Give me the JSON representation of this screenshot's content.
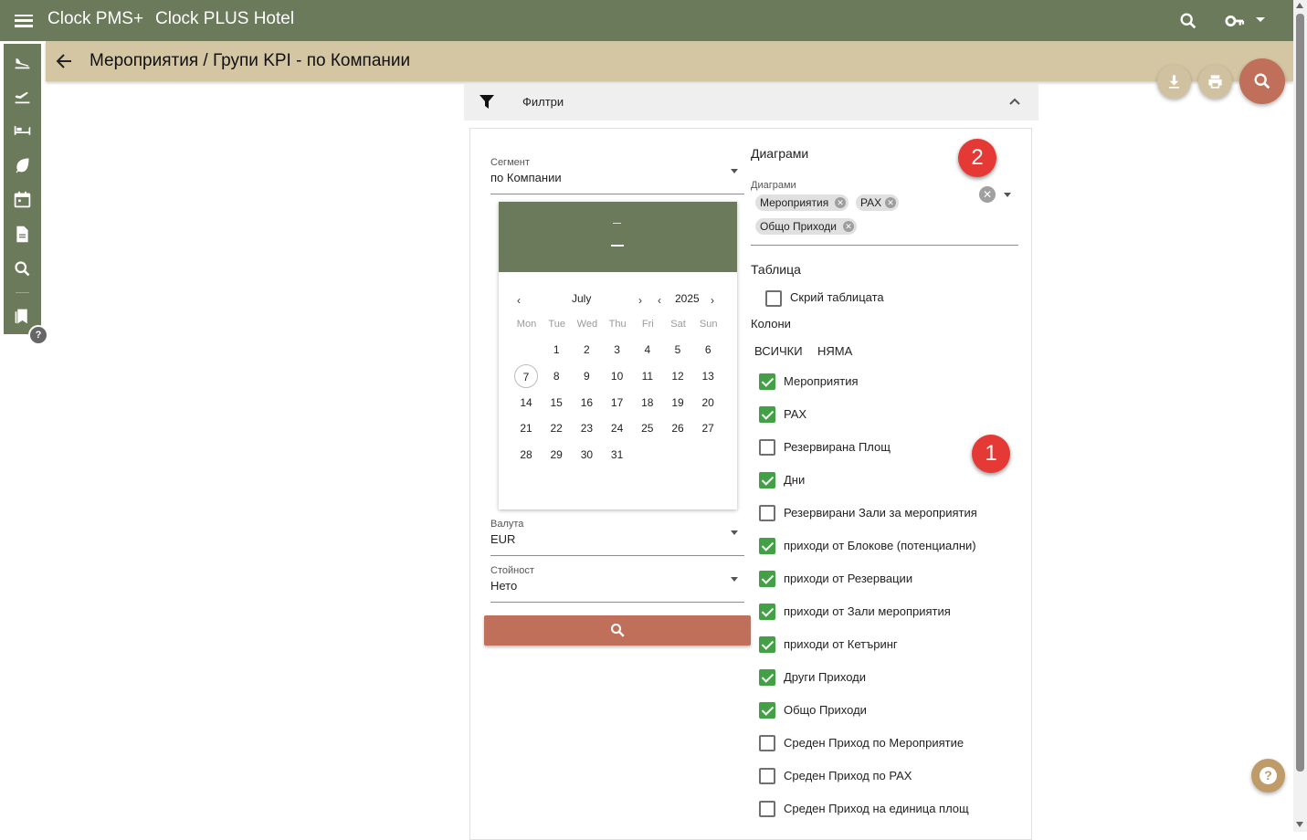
{
  "topbar": {
    "app_title": "Clock PMS+",
    "hotel_name": "Clock PLUS Hotel",
    "icons": [
      "menu-icon",
      "search-icon",
      "key-icon",
      "caret-down-icon"
    ]
  },
  "header": {
    "title": "Мероприятия / Групи KPI - по Компании"
  },
  "sidebar": {
    "icons": [
      "arrivals-icon",
      "departures-icon",
      "bed-icon",
      "leaf-icon",
      "calendar-icon",
      "document-icon",
      "search-icon",
      "bookmarks-icon",
      "help-icon"
    ]
  },
  "filters": {
    "label": "Филтри"
  },
  "segment": {
    "label": "Сегмент",
    "value": "по Компании"
  },
  "calendar": {
    "month": "July",
    "year": "2025",
    "weekdays": [
      "Mon",
      "Tue",
      "Wed",
      "Thu",
      "Fri",
      "Sat",
      "Sun"
    ],
    "days": [
      "1",
      "2",
      "3",
      "4",
      "5",
      "6",
      "7",
      "8",
      "9",
      "10",
      "11",
      "12",
      "13",
      "14",
      "15",
      "16",
      "17",
      "18",
      "19",
      "20",
      "21",
      "22",
      "23",
      "24",
      "25",
      "26",
      "27",
      "28",
      "29",
      "30",
      "31"
    ],
    "today": "7"
  },
  "currency": {
    "label": "Валута",
    "value": "EUR"
  },
  "value_type": {
    "label": "Стойност",
    "value": "Нето"
  },
  "charts": {
    "section_title": "Диаграми",
    "field_label": "Диаграми",
    "chips": [
      "Мероприятия",
      "PAX",
      "Общо Приходи"
    ]
  },
  "table": {
    "section_title": "Таблица",
    "hide_table_label": "Скрий таблицата",
    "hide_table_checked": false,
    "columns_title": "Колони",
    "all_label": "ВСИЧКИ",
    "none_label": "НЯМА",
    "columns": [
      {
        "label": "Мероприятия",
        "checked": true
      },
      {
        "label": "PAX",
        "checked": true
      },
      {
        "label": "Резервирана Площ",
        "checked": false
      },
      {
        "label": "Дни",
        "checked": true
      },
      {
        "label": "Резервирани Зали за мероприятия",
        "checked": false
      },
      {
        "label": "приходи от Блокове (потенциални)",
        "checked": true
      },
      {
        "label": "приходи от Резервации",
        "checked": true
      },
      {
        "label": "приходи от Зали мероприятия",
        "checked": true
      },
      {
        "label": "приходи от Кетъринг",
        "checked": true
      },
      {
        "label": "Други Приходи",
        "checked": true
      },
      {
        "label": "Общо Приходи",
        "checked": true
      },
      {
        "label": "Среден Приход по Мероприятие",
        "checked": false
      },
      {
        "label": "Среден Приход по PAX",
        "checked": false
      },
      {
        "label": "Среден Приход на единица площ",
        "checked": false
      }
    ]
  },
  "badges": [
    "2",
    "1"
  ],
  "colors": {
    "primary": "#6b7a5a",
    "header": "#d4c5a3",
    "accent": "#c0705a",
    "check": "#43a047",
    "badge": "#e53935"
  }
}
